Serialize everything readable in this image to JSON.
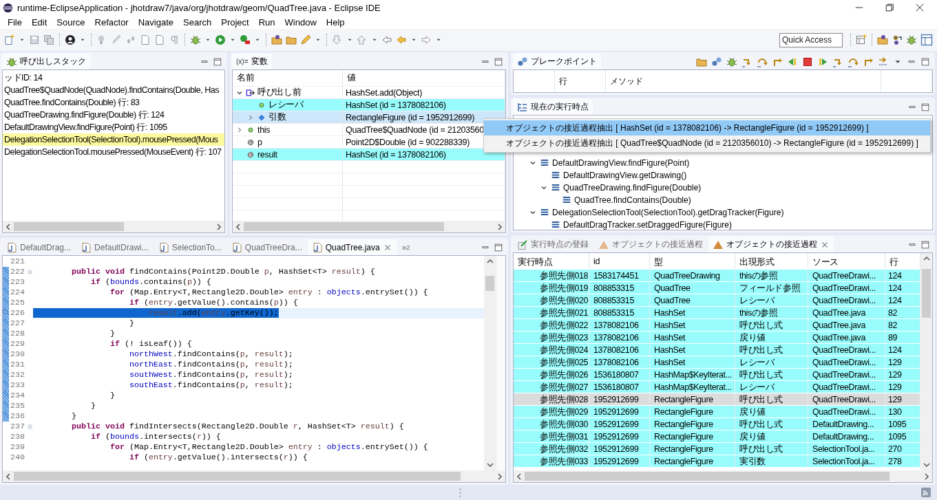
{
  "window": {
    "title": "runtime-EclipseApplication - jhotdraw7/java/org/jhotdraw/geom/QuadTree.java - Eclipse IDE"
  },
  "menu": [
    "File",
    "Edit",
    "Source",
    "Refactor",
    "Navigate",
    "Search",
    "Project",
    "Run",
    "Window",
    "Help"
  ],
  "quick_access": {
    "placeholder": "Quick Access"
  },
  "call_stack": {
    "tab": "呼び出しスタック",
    "frames": [
      {
        "text": "ッドID: 14",
        "highlighted": false
      },
      {
        "text": "QuadTree$QuadNode(QuadNode).findContains(Double, Has",
        "highlighted": false
      },
      {
        "text": "QuadTree.findContains(Double) 行: 83",
        "highlighted": false
      },
      {
        "text": "QuadTreeDrawing.findFigure(Double) 行: 124",
        "highlighted": false
      },
      {
        "text": "DefaultDrawingView.findFigure(Point) 行: 1095",
        "highlighted": false
      },
      {
        "text": "DelegationSelectionTool(SelectionTool).mousePressed(Mous",
        "highlighted": true
      },
      {
        "text": "DelegationSelectionTool.mousePressed(MouseEvent) 行: 107",
        "highlighted": false
      }
    ]
  },
  "variables": {
    "tab_icon": "(x)=",
    "tab": "変数",
    "columns": [
      "名前",
      "値"
    ],
    "rows": [
      {
        "name": "呼び出し前",
        "value": "HashSet.add(Object)",
        "kind": "call",
        "expanded": true,
        "highlighted": false,
        "selected": false,
        "children": [
          {
            "name": "レシーバ",
            "value": "HashSet (id = 1378082106)",
            "kind": "field",
            "highlighted": true,
            "selected": false
          },
          {
            "name": "引数",
            "value": "RectangleFigure (id = 1952912699)",
            "kind": "argument",
            "expanded": false,
            "highlighted": false,
            "selected": true
          }
        ]
      },
      {
        "name": "this",
        "value": "QuadTree$QuadNode (id = 21203560",
        "kind": "field",
        "expanded": false,
        "highlighted": false,
        "selected": false
      },
      {
        "name": "p",
        "value": "Point2D$Double (id = 902288339)",
        "kind": "local",
        "highlighted": false,
        "selected": false
      },
      {
        "name": "result",
        "value": "HashSet (id = 1378082106)",
        "kind": "local",
        "highlighted": true,
        "selected": false
      }
    ]
  },
  "breakpoints": {
    "tab": "ブレークポイント",
    "columns": [
      "行",
      "メソッド"
    ]
  },
  "execution_points": {
    "tab": "現在の実行時点",
    "tree": [
      {
        "label": "DefaultDrawingView.findFigure(Point)",
        "expanded": true,
        "children": [
          {
            "label": "DefaultDrawingView.getDrawing()"
          },
          {
            "label": "QuadTreeDrawing.findFigure(Double)",
            "expanded": true,
            "children": [
              {
                "label": "QuadTree.findContains(Double)"
              }
            ]
          }
        ]
      },
      {
        "label": "DelegationSelectionTool(SelectionTool).getDragTracker(Figure)",
        "expanded": true,
        "children": [
          {
            "label": "DefaultDragTracker.setDraggedFigure(Figure)"
          }
        ]
      }
    ]
  },
  "context_menu": {
    "items": [
      {
        "label": "オブジェクトの接近過程抽出 [ HashSet (id = 1378082106) -> RectangleFigure (id = 1952912699) ]",
        "selected": true
      },
      {
        "label": "オブジェクトの接近過程抽出 [ QuadTree$QuadNode (id = 2120356010) -> RectangleFigure (id = 1952912699) ]",
        "selected": false
      }
    ]
  },
  "editor": {
    "tabs": [
      {
        "label": "DefaultDrag...",
        "selected": false
      },
      {
        "label": "DefaultDrawi...",
        "selected": false
      },
      {
        "label": "SelectionTo...",
        "selected": false
      },
      {
        "label": "QuadTreeDra...",
        "selected": false
      },
      {
        "label": "QuadTree.java",
        "selected": true
      }
    ],
    "overflow": "»",
    "overflow_count": "2",
    "lines": [
      {
        "number": "221",
        "current": false,
        "in_range": false,
        "foldable": false
      },
      {
        "number": "222",
        "current": false,
        "in_range": true,
        "foldable": true,
        "segments": [
          {
            "kind": "keyword",
            "text": "        public void"
          },
          {
            "kind": "plain",
            "text": " findContains(Point2D.Double "
          },
          {
            "kind": "variable",
            "text": "p"
          },
          {
            "kind": "plain",
            "text": ", HashSet<T> "
          },
          {
            "kind": "variable",
            "text": "result"
          },
          {
            "kind": "plain",
            "text": ") {"
          }
        ]
      },
      {
        "number": "223",
        "current": false,
        "in_range": true,
        "foldable": false,
        "segments": [
          {
            "kind": "keyword",
            "text": "            if"
          },
          {
            "kind": "plain",
            "text": " ("
          },
          {
            "kind": "field",
            "text": "bounds"
          },
          {
            "kind": "plain",
            "text": ".contains("
          },
          {
            "kind": "variable",
            "text": "p"
          },
          {
            "kind": "plain",
            "text": ")) {"
          }
        ]
      },
      {
        "number": "224",
        "current": false,
        "in_range": true,
        "foldable": false,
        "segments": [
          {
            "kind": "keyword",
            "text": "                for"
          },
          {
            "kind": "plain",
            "text": " (Map.Entry<T,Rectangle2D.Double> "
          },
          {
            "kind": "variable",
            "text": "entry"
          },
          {
            "kind": "plain",
            "text": " : "
          },
          {
            "kind": "field",
            "text": "objects"
          },
          {
            "kind": "plain",
            "text": ".entrySet()) {"
          }
        ]
      },
      {
        "number": "225",
        "current": false,
        "in_range": true,
        "foldable": false,
        "segments": [
          {
            "kind": "keyword",
            "text": "                    if"
          },
          {
            "kind": "plain",
            "text": " ("
          },
          {
            "kind": "variable",
            "text": "entry"
          },
          {
            "kind": "plain",
            "text": ".getValue().contains("
          },
          {
            "kind": "variable",
            "text": "p"
          },
          {
            "kind": "plain",
            "text": ")) {"
          }
        ]
      },
      {
        "number": "226",
        "current": true,
        "in_range": true,
        "foldable": false,
        "segments": [
          {
            "kind": "variable",
            "text": "                        result"
          },
          {
            "kind": "plain",
            "text": ".add("
          },
          {
            "kind": "variable",
            "text": "entry"
          },
          {
            "kind": "plain",
            "text": ".getKey());"
          }
        ]
      },
      {
        "number": "227",
        "current": false,
        "in_range": true,
        "foldable": false,
        "segments": [
          {
            "kind": "plain",
            "text": "                    }"
          }
        ]
      },
      {
        "number": "228",
        "current": false,
        "in_range": true,
        "foldable": false,
        "segments": [
          {
            "kind": "plain",
            "text": "                }"
          }
        ]
      },
      {
        "number": "229",
        "current": false,
        "in_range": true,
        "foldable": false,
        "segments": [
          {
            "kind": "keyword",
            "text": "                if"
          },
          {
            "kind": "plain",
            "text": " (! isLeaf()) {"
          }
        ]
      },
      {
        "number": "230",
        "current": false,
        "in_range": true,
        "foldable": false,
        "segments": [
          {
            "kind": "field",
            "text": "                    northWest"
          },
          {
            "kind": "plain",
            "text": ".findContains("
          },
          {
            "kind": "variable",
            "text": "p"
          },
          {
            "kind": "plain",
            "text": ", "
          },
          {
            "kind": "variable",
            "text": "result"
          },
          {
            "kind": "plain",
            "text": ");"
          }
        ]
      },
      {
        "number": "231",
        "current": false,
        "in_range": true,
        "foldable": false,
        "segments": [
          {
            "kind": "field",
            "text": "                    northEast"
          },
          {
            "kind": "plain",
            "text": ".findContains("
          },
          {
            "kind": "variable",
            "text": "p"
          },
          {
            "kind": "plain",
            "text": ", "
          },
          {
            "kind": "variable",
            "text": "result"
          },
          {
            "kind": "plain",
            "text": ");"
          }
        ]
      },
      {
        "number": "232",
        "current": false,
        "in_range": true,
        "foldable": false,
        "segments": [
          {
            "kind": "field",
            "text": "                    southWest"
          },
          {
            "kind": "plain",
            "text": ".findContains("
          },
          {
            "kind": "variable",
            "text": "p"
          },
          {
            "kind": "plain",
            "text": ", "
          },
          {
            "kind": "variable",
            "text": "result"
          },
          {
            "kind": "plain",
            "text": ");"
          }
        ]
      },
      {
        "number": "233",
        "current": false,
        "in_range": true,
        "foldable": false,
        "segments": [
          {
            "kind": "field",
            "text": "                    southEast"
          },
          {
            "kind": "plain",
            "text": ".findContains("
          },
          {
            "kind": "variable",
            "text": "p"
          },
          {
            "kind": "plain",
            "text": ", "
          },
          {
            "kind": "variable",
            "text": "result"
          },
          {
            "kind": "plain",
            "text": ");"
          }
        ]
      },
      {
        "number": "234",
        "current": false,
        "in_range": true,
        "foldable": false,
        "segments": [
          {
            "kind": "plain",
            "text": "                }"
          }
        ]
      },
      {
        "number": "235",
        "current": false,
        "in_range": true,
        "foldable": false,
        "segments": [
          {
            "kind": "plain",
            "text": "            }"
          }
        ]
      },
      {
        "number": "236",
        "current": false,
        "in_range": true,
        "foldable": false,
        "segments": [
          {
            "kind": "plain",
            "text": "        }"
          }
        ]
      },
      {
        "number": "237",
        "current": false,
        "in_range": false,
        "foldable": true,
        "segments": [
          {
            "kind": "keyword",
            "text": "        public void"
          },
          {
            "kind": "plain",
            "text": " findIntersects(Rectangle2D.Double "
          },
          {
            "kind": "variable",
            "text": "r"
          },
          {
            "kind": "plain",
            "text": ", HashSet<T> "
          },
          {
            "kind": "variable",
            "text": "result"
          },
          {
            "kind": "plain",
            "text": ") {"
          }
        ]
      },
      {
        "number": "238",
        "current": false,
        "in_range": false,
        "foldable": false,
        "segments": [
          {
            "kind": "keyword",
            "text": "            if"
          },
          {
            "kind": "plain",
            "text": " ("
          },
          {
            "kind": "field",
            "text": "bounds"
          },
          {
            "kind": "plain",
            "text": ".intersects("
          },
          {
            "kind": "variable",
            "text": "r"
          },
          {
            "kind": "plain",
            "text": ")) {"
          }
        ]
      },
      {
        "number": "239",
        "current": false,
        "in_range": false,
        "foldable": false,
        "segments": [
          {
            "kind": "keyword",
            "text": "                for"
          },
          {
            "kind": "plain",
            "text": " (Map.Entry<T,Rectangle2D.Double> "
          },
          {
            "kind": "variable",
            "text": "entry"
          },
          {
            "kind": "plain",
            "text": " : "
          },
          {
            "kind": "field",
            "text": "objects"
          },
          {
            "kind": "plain",
            "text": ".entrySet()) {"
          }
        ]
      },
      {
        "number": "240",
        "current": false,
        "in_range": false,
        "foldable": false,
        "segments": [
          {
            "kind": "keyword",
            "text": "                    if"
          },
          {
            "kind": "plain",
            "text": " ("
          },
          {
            "kind": "variable",
            "text": "entry"
          },
          {
            "kind": "plain",
            "text": ".getValue().intersects("
          },
          {
            "kind": "variable",
            "text": "r"
          },
          {
            "kind": "plain",
            "text": ")) {"
          }
        ]
      }
    ]
  },
  "trace": {
    "tabs": [
      {
        "label": "実行時点の登録",
        "kind": "register",
        "selected": false
      },
      {
        "label": "オブジェクトの接近過程",
        "kind": "trace",
        "selected": false
      },
      {
        "label": "オブジェクトの接近過程",
        "kind": "trace",
        "selected": true
      }
    ],
    "columns": [
      "実行時点",
      "id",
      "型",
      "出現形式",
      "ソース",
      "行"
    ],
    "rows": [
      {
        "cells": [
          "参照先側018",
          "1583174451",
          "QuadTreeDrawing",
          "thisの参照",
          "QuadTreeDrawi...",
          "124"
        ],
        "selected": false
      },
      {
        "cells": [
          "参照先側019",
          "808853315",
          "QuadTree",
          "フィールド参照",
          "QuadTreeDrawi...",
          "124"
        ],
        "selected": false
      },
      {
        "cells": [
          "参照先側020",
          "808853315",
          "QuadTree",
          "レシーバ",
          "QuadTreeDrawi...",
          "124"
        ],
        "selected": false
      },
      {
        "cells": [
          "参照先側021",
          "808853315",
          "HashSet",
          "thisの参照",
          "QuadTree.java",
          "82"
        ],
        "selected": false
      },
      {
        "cells": [
          "参照先側022",
          "1378082106",
          "HashSet",
          "呼び出し式",
          "QuadTree.java",
          "82"
        ],
        "selected": false
      },
      {
        "cells": [
          "参照先側023",
          "1378082106",
          "HashSet",
          "戻り値",
          "QuadTree.java",
          "89"
        ],
        "selected": false
      },
      {
        "cells": [
          "参照先側024",
          "1378082106",
          "HashSet",
          "呼び出し式",
          "QuadTreeDrawi...",
          "124"
        ],
        "selected": false
      },
      {
        "cells": [
          "参照先側025",
          "1378082106",
          "HashSet",
          "レシーバ",
          "QuadTreeDrawi...",
          "129"
        ],
        "selected": false
      },
      {
        "cells": [
          "参照先側026",
          "1536180807",
          "HashMap$KeyIterat...",
          "呼び出し式",
          "QuadTreeDrawi...",
          "129"
        ],
        "selected": false
      },
      {
        "cells": [
          "参照先側027",
          "1536180807",
          "HashMap$KeyIterat...",
          "レシーバ",
          "QuadTreeDrawi...",
          "129"
        ],
        "selected": false
      },
      {
        "cells": [
          "参照先側028",
          "1952912699",
          "RectangleFigure",
          "呼び出し式",
          "QuadTreeDrawi...",
          "129"
        ],
        "selected": true
      },
      {
        "cells": [
          "参照先側029",
          "1952912699",
          "RectangleFigure",
          "戻り値",
          "QuadTreeDrawi...",
          "130"
        ],
        "selected": false
      },
      {
        "cells": [
          "参照先側030",
          "1952912699",
          "RectangleFigure",
          "呼び出し式",
          "DefaultDrawing...",
          "1095"
        ],
        "selected": false
      },
      {
        "cells": [
          "参照先側031",
          "1952912699",
          "RectangleFigure",
          "戻り値",
          "DefaultDrawing...",
          "1095"
        ],
        "selected": false
      },
      {
        "cells": [
          "参照先側032",
          "1952912699",
          "RectangleFigure",
          "呼び出し式",
          "SelectionTool.ja...",
          "270"
        ],
        "selected": false
      },
      {
        "cells": [
          "参照先側033",
          "1952912699",
          "RectangleFigure",
          "実引数",
          "SelectionTool.ja...",
          "278"
        ],
        "selected": false
      }
    ]
  }
}
